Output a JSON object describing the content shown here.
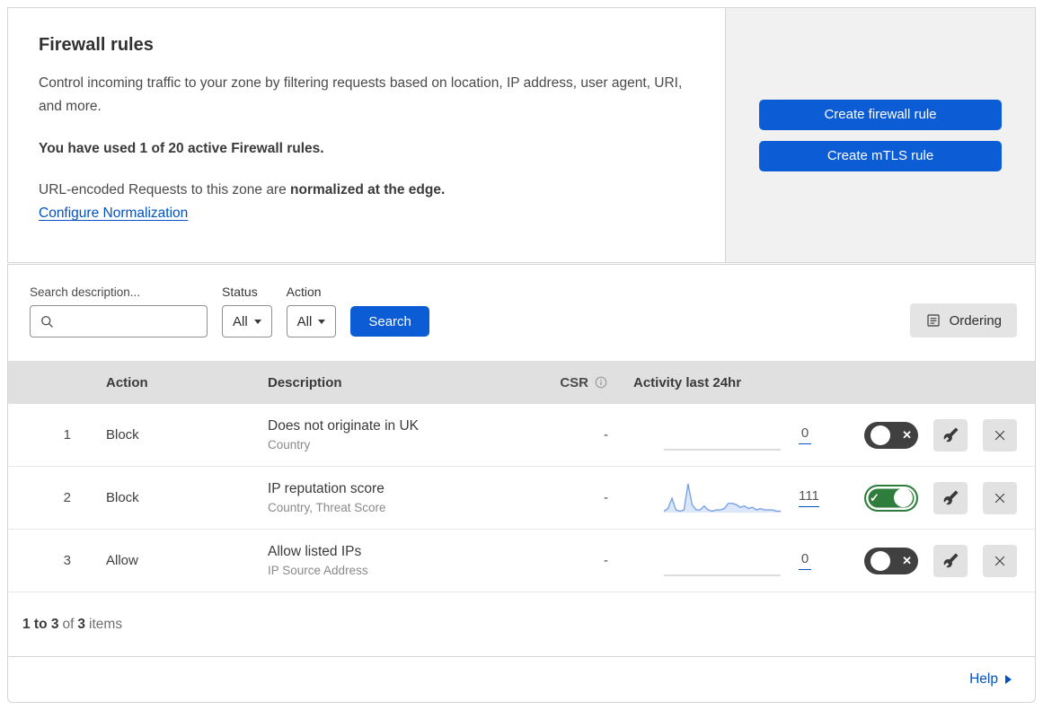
{
  "intro": {
    "title": "Firewall rules",
    "description": "Control incoming traffic to your zone by filtering requests based on location, IP address, user agent, URI, and more.",
    "usage": "You have used 1 of 20 active Firewall rules.",
    "normalization_text": "URL-encoded Requests to this zone are",
    "normalization_bold": "normalized at the edge.",
    "normalization_link": "Configure Normalization"
  },
  "cta": {
    "create_firewall_label": "Create firewall rule",
    "create_mtls_label": "Create mTLS rule"
  },
  "filters": {
    "search_label": "Search description...",
    "status_label": "Status",
    "status_value": "All",
    "action_label": "Action",
    "action_value": "All",
    "search_button_label": "Search",
    "ordering_button_label": "Ordering"
  },
  "table": {
    "headers": {
      "action": "Action",
      "description": "Description",
      "csr": "CSR",
      "activity": "Activity last 24hr"
    },
    "rows": [
      {
        "priority": "1",
        "action": "Block",
        "description": "Does not originate in UK",
        "criteria": "Country",
        "csr": "-",
        "activity_count": "0",
        "enabled": false,
        "sparkline": null
      },
      {
        "priority": "2",
        "action": "Block",
        "description": "IP reputation score",
        "criteria": "Country, Threat Score",
        "csr": "-",
        "activity_count": "111",
        "enabled": true,
        "sparkline": [
          1,
          3,
          11,
          2,
          1,
          2,
          22,
          6,
          2,
          2,
          5,
          2,
          1,
          2,
          2,
          3,
          7,
          7,
          6,
          4,
          5,
          3,
          4,
          2,
          3,
          2,
          2,
          2,
          1,
          1
        ]
      },
      {
        "priority": "3",
        "action": "Allow",
        "description": "Allow listed IPs",
        "criteria": "IP Source Address",
        "csr": "-",
        "activity_count": "0",
        "enabled": false,
        "sparkline": null
      }
    ]
  },
  "footer": {
    "range": "1 to 3",
    "of": "of",
    "total": "3",
    "items": "items"
  },
  "help": {
    "label": "Help"
  },
  "icons": {
    "toggle_on_symbol": "✓",
    "toggle_off_symbol": "✕"
  },
  "colors": {
    "accent_blue": "#0b5cd5",
    "link_blue": "#0051c3",
    "toggle_on_green": "#2e7d3c",
    "toggle_off_gray": "#404040",
    "sparkline_stroke": "#7aa3e8",
    "sparkline_fill": "#dce8f9",
    "table_header_bg": "#e0e0e0",
    "panel_bg": "#f1f1f2"
  }
}
